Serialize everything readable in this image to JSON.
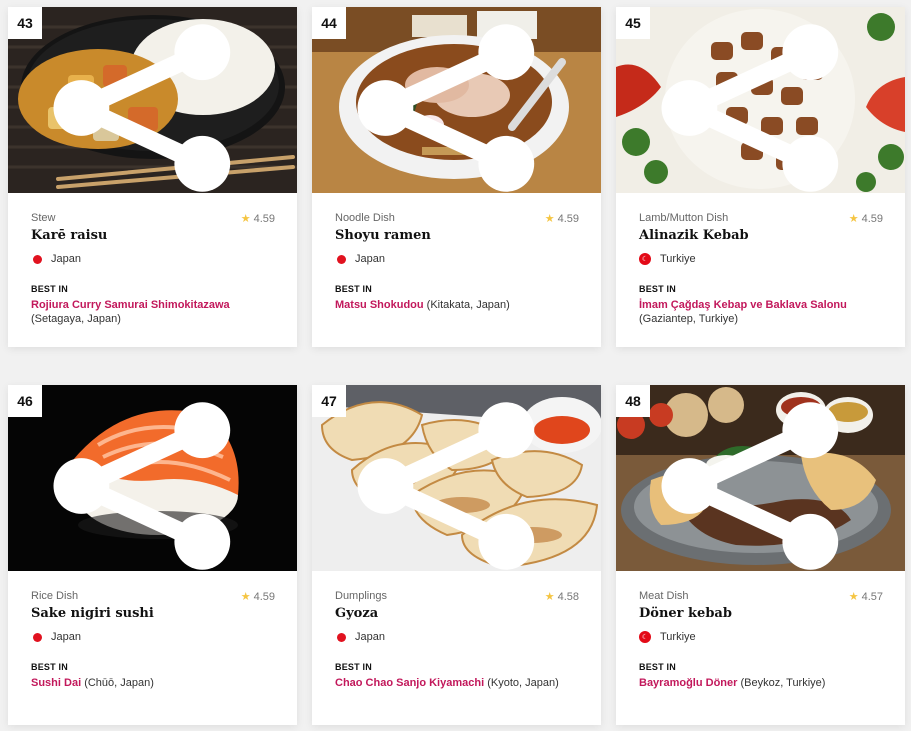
{
  "cards": [
    {
      "rank": "43",
      "type": "Stew",
      "rating": "4.59",
      "name": "Karē raisu",
      "country": "Japan",
      "best_in_label": "BEST IN",
      "restaurant": "Rojiura Curry Samurai Shimokitazawa",
      "location": "(Setagaya, Japan)"
    },
    {
      "rank": "44",
      "type": "Noodle Dish",
      "rating": "4.59",
      "name": "Shoyu ramen",
      "country": "Japan",
      "best_in_label": "BEST IN",
      "restaurant": "Matsu Shokudou",
      "location": "(Kitakata, Japan)"
    },
    {
      "rank": "45",
      "type": "Lamb/Mutton Dish",
      "rating": "4.59",
      "name": "Alinazik Kebab",
      "country": "Turkiye",
      "best_in_label": "BEST IN",
      "restaurant": "İmam Çağdaş Kebap ve Baklava Salonu",
      "location": "(Gaziantep, Turkiye)"
    },
    {
      "rank": "46",
      "type": "Rice Dish",
      "rating": "4.59",
      "name": "Sake nigiri sushi",
      "country": "Japan",
      "best_in_label": "BEST IN",
      "restaurant": "Sushi Dai",
      "location": "(Chūō, Japan)"
    },
    {
      "rank": "47",
      "type": "Dumplings",
      "rating": "4.58",
      "name": "Gyoza",
      "country": "Japan",
      "best_in_label": "BEST IN",
      "restaurant": "Chao Chao Sanjo Kiyamachi",
      "location": "(Kyoto, Japan)"
    },
    {
      "rank": "48",
      "type": "Meat Dish",
      "rating": "4.57",
      "name": "Döner kebab",
      "country": "Turkiye",
      "best_in_label": "BEST IN",
      "restaurant": "Bayramoğlu Döner",
      "location": "(Beykoz, Turkiye)"
    }
  ],
  "colors": {
    "link": "#c2185b",
    "star": "#f5c542",
    "japan_flag": "#e1121f",
    "turkey_flag": "#e30a17"
  },
  "icons": {
    "share": "share-icon",
    "star": "star-icon"
  }
}
